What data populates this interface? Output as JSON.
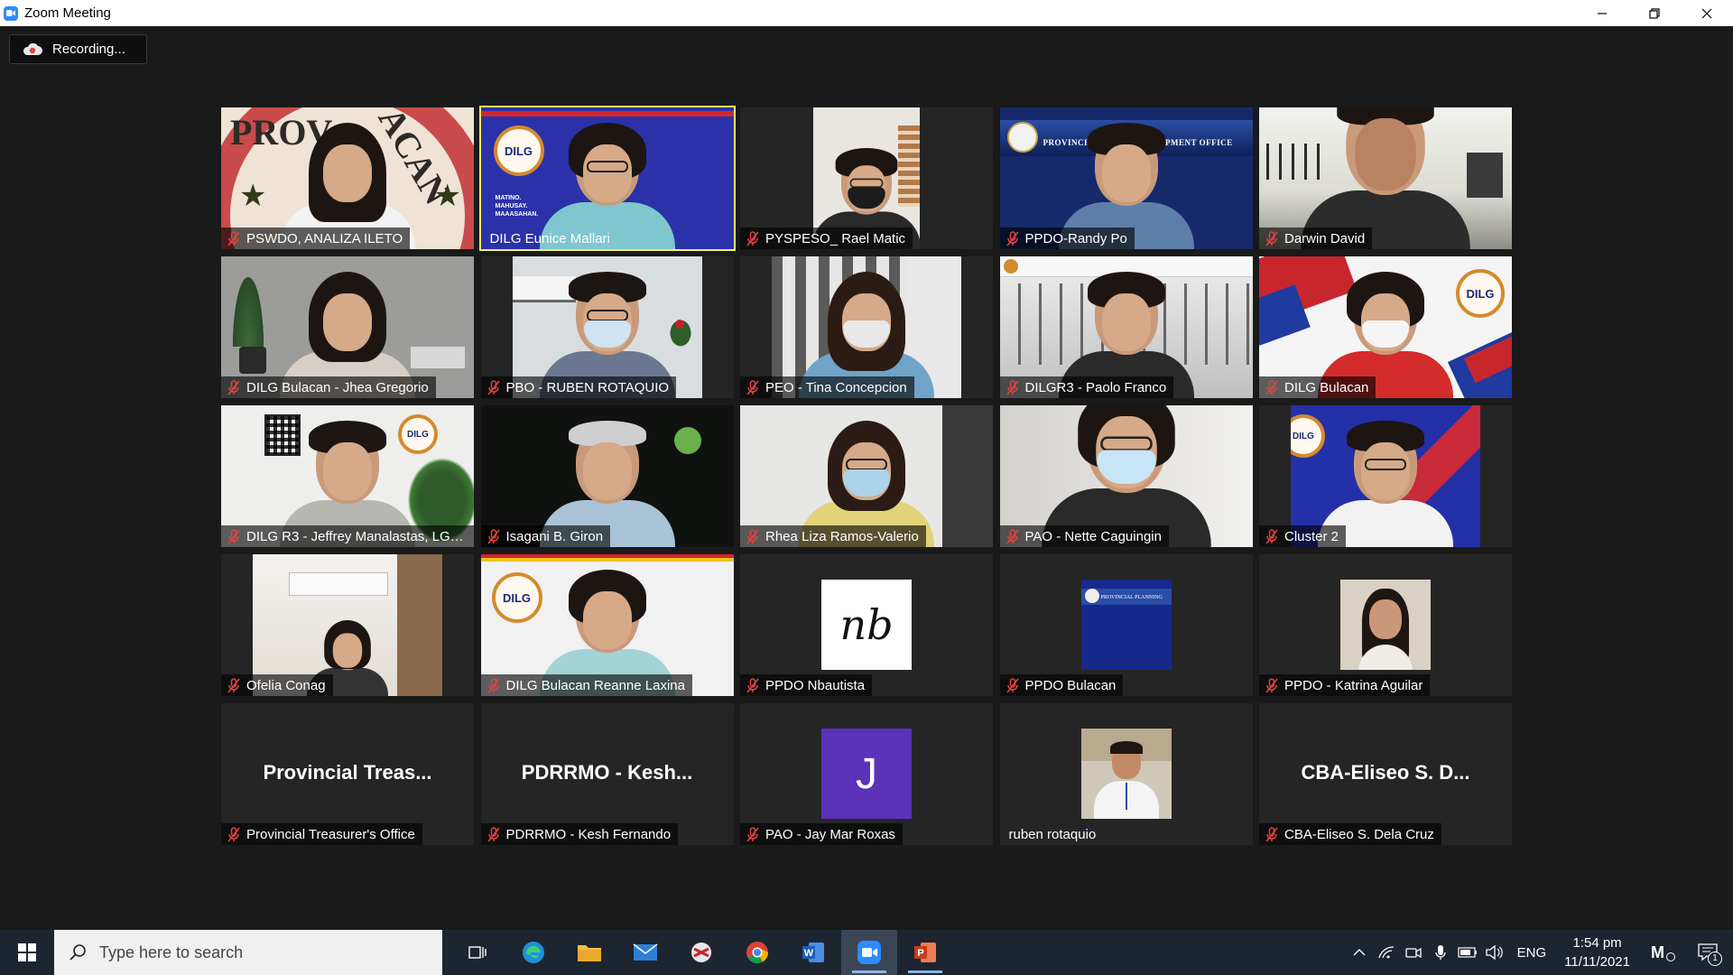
{
  "window": {
    "title": "Zoom Meeting"
  },
  "recording": {
    "label": "Recording..."
  },
  "participants": [
    {
      "name": "PSWDO, ANALIZA ILETO",
      "muted": true
    },
    {
      "name": "DILG Eunice Mallari",
      "muted": false
    },
    {
      "name": "PYSPESO_ Rael Matic",
      "muted": true
    },
    {
      "name": "PPDO-Randy Po",
      "muted": true
    },
    {
      "name": "Darwin David",
      "muted": true
    },
    {
      "name": "DILG Bulacan - Jhea Gregorio",
      "muted": true
    },
    {
      "name": "PBO - RUBEN ROTAQUIO",
      "muted": true
    },
    {
      "name": "PEO - Tina Concepcion",
      "muted": true
    },
    {
      "name": "DILGR3 - Paolo Franco",
      "muted": true
    },
    {
      "name": "DILG Bulacan",
      "muted": true
    },
    {
      "name": "DILG R3 - Jeffrey Manalastas, LGO...",
      "muted": true
    },
    {
      "name": "Isagani B. Giron",
      "muted": true
    },
    {
      "name": "Rhea Liza Ramos-Valerio",
      "muted": true
    },
    {
      "name": "PAO - Nette Caguingin",
      "muted": true
    },
    {
      "name": "Cluster 2",
      "muted": true
    },
    {
      "name": "Ofelia Conag",
      "muted": true
    },
    {
      "name": "DILG Bulacan Reanne Laxina",
      "muted": true
    },
    {
      "name": "PPDO Nbautista",
      "muted": true
    },
    {
      "name": "PPDO Bulacan",
      "muted": true
    },
    {
      "name": "PPDO - Katrina Aguilar",
      "muted": true
    },
    {
      "name": "Provincial Treasurer's Office",
      "muted": true,
      "display": "Provincial Treas..."
    },
    {
      "name": "PDRRMO - Kesh Fernando",
      "muted": true,
      "display": "PDRRMO - Kesh..."
    },
    {
      "name": "PAO - Jay Mar Roxas",
      "muted": true,
      "avatar_letter": "J"
    },
    {
      "name": "ruben rotaquio",
      "muted": false
    },
    {
      "name": "CBA-Eliseo S. Dela Cruz",
      "muted": true,
      "display": "CBA-Eliseo S. D..."
    }
  ],
  "tile_text": {
    "dilg_seal": "DILG",
    "nb_logo": "nb",
    "eunice_slogan": "MATINO. MAHUSAY. MAAASAHAN.",
    "ppdo_banner": "PROVINCIAL PLAN     DEVELOPMENT OFFICE",
    "ppdo_small": "PROVINCIAL PLANNING",
    "pswdo_ring_left": "PROV",
    "pswdo_ring_right": "ACAN"
  },
  "taskbar": {
    "search_placeholder": "Type here to search",
    "language": "ENG",
    "time": "1:54 pm",
    "date": "11/11/2021",
    "notification_count": "1"
  },
  "colors": {
    "active_speaker": "#f1f35c",
    "muted_mic": "#e0443e",
    "avatar_purple": "#5b32b8",
    "zoom_blue": "#2d8cff"
  }
}
